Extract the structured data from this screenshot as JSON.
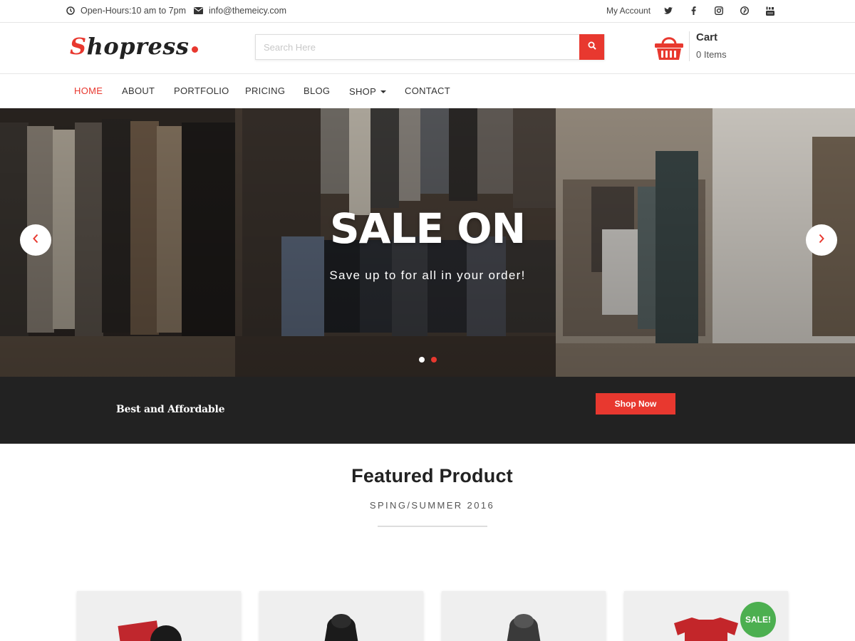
{
  "topbar": {
    "hours": "Open-Hours:10 am to 7pm",
    "email": "info@themeicy.com",
    "account": "My Account",
    "social": [
      "twitter-icon",
      "facebook-icon",
      "instagram-icon",
      "pinterest-icon",
      "youtube-icon"
    ]
  },
  "header": {
    "logo_first": "S",
    "logo_rest": "hopress",
    "search_placeholder": "Search Here",
    "cart_title": "Cart",
    "cart_count": "0 Items"
  },
  "nav": {
    "items": [
      "HOME",
      "ABOUT",
      "PORTFOLIO",
      "PRICING",
      "BLOG",
      "SHOP",
      "CONTACT"
    ],
    "active": "HOME"
  },
  "hero": {
    "title": "SALE ON",
    "subtitle": "Save up to for all in your order!",
    "slide_count": 2,
    "active_slide": 2
  },
  "promo": {
    "text": "Best and Affordable",
    "button": "Shop Now"
  },
  "featured": {
    "title": "Featured Product",
    "subtitle": "SPING/SUMMER 2016",
    "sale_badge": "SALE!"
  },
  "colors": {
    "accent": "#e8382f",
    "dark_band": "#222222",
    "sale_badge": "#4caf50"
  }
}
